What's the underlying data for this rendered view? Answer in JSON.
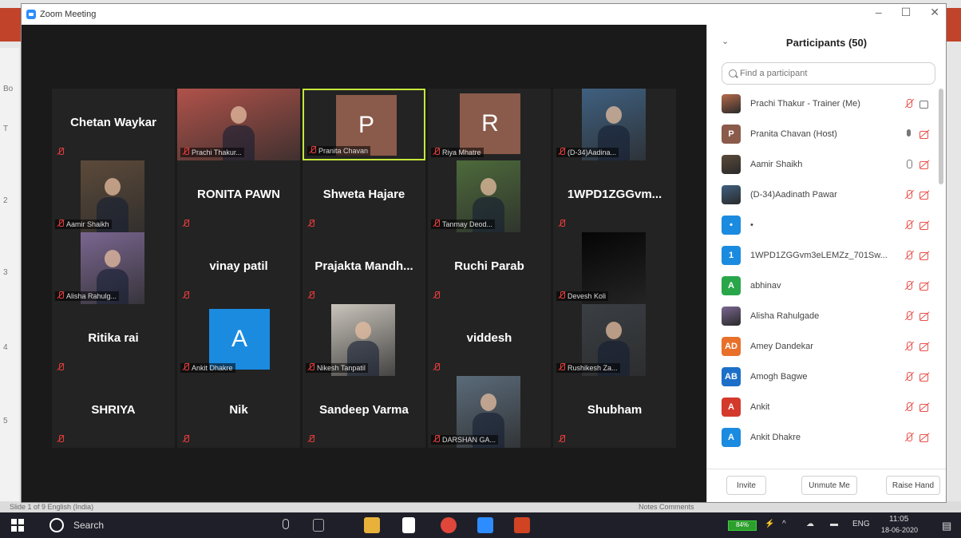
{
  "window": {
    "title": "Zoom Meeting",
    "minimize": "–",
    "maximize": "☐",
    "close": "✕"
  },
  "background_app": {
    "left_labels": [
      "Bo",
      "T",
      "2",
      "3",
      "4",
      "5"
    ],
    "status_left": "Slide 1 of 9    English (India)",
    "status_right": "Notes   Comments"
  },
  "gallery": {
    "tiles": [
      {
        "name": "Chetan Waykar",
        "kind": "text"
      },
      {
        "name": "Prachi Thakur...",
        "kind": "photo",
        "photo_color": "#b0524a"
      },
      {
        "name": "Pranita Chavan",
        "kind": "letter",
        "letter": "P",
        "color": "#8a5a4a",
        "active": true
      },
      {
        "name": "Riya Mhatre",
        "kind": "letter",
        "letter": "R",
        "color": "#8a5a4a"
      },
      {
        "name": "(D-34)Aadina...",
        "kind": "photo",
        "photo_color": "#3f6080"
      },
      {
        "name": "Aamir Shaikh",
        "kind": "photo",
        "photo_color": "#5c4a3a"
      },
      {
        "name": "RONITA PAWN",
        "kind": "text"
      },
      {
        "name": "Shweta Hajare",
        "kind": "text"
      },
      {
        "name": "Tanmay Deod...",
        "kind": "photo",
        "photo_color": "#4d6a3b"
      },
      {
        "name": "1WPD1ZGGvm...",
        "kind": "text"
      },
      {
        "name": "Alisha Rahulg...",
        "kind": "photo",
        "photo_color": "#7a6690"
      },
      {
        "name": "vinay patil",
        "kind": "text"
      },
      {
        "name": "Prajakta  Mandh...",
        "kind": "text"
      },
      {
        "name": "Ruchi Parab",
        "kind": "text"
      },
      {
        "name": "Devesh Koli",
        "kind": "photo",
        "photo_color": "#050505"
      },
      {
        "name": "Ritika rai",
        "kind": "text"
      },
      {
        "name": "Ankit Dhakre",
        "kind": "letter",
        "letter": "A",
        "color": "#1b8be0"
      },
      {
        "name": "Nikesh Tanpatil",
        "kind": "photo",
        "photo_color": "#c9c4bb"
      },
      {
        "name": "viddesh",
        "kind": "text"
      },
      {
        "name": "Rushikesh Za...",
        "kind": "photo",
        "photo_color": "#3a3f44"
      },
      {
        "name": "SHRIYA",
        "kind": "text"
      },
      {
        "name": "Nik",
        "kind": "text"
      },
      {
        "name": "Sandeep Varma",
        "kind": "text"
      },
      {
        "name": "DARSHAN GA...",
        "kind": "photo",
        "photo_color": "#5b6b7a"
      },
      {
        "name": "Shubham",
        "kind": "text"
      }
    ]
  },
  "participants": {
    "title": "Participants (50)",
    "search_placeholder": "Find a participant",
    "list": [
      {
        "name": "Prachi Thakur - Trainer (Me)",
        "avatar_kind": "photo",
        "avatar_color": "#b56a4a",
        "mic": "muted",
        "video": "on"
      },
      {
        "name": "Pranita Chavan (Host)",
        "avatar_kind": "letter",
        "initials": "P",
        "avatar_color": "#8a5a4a",
        "mic": "on",
        "video": "off"
      },
      {
        "name": "Aamir Shaikh",
        "avatar_kind": "photo",
        "avatar_color": "#5c4a3a",
        "mic": "open",
        "video": "off"
      },
      {
        "name": "(D-34)Aadinath Pawar",
        "avatar_kind": "photo",
        "avatar_color": "#3f6080",
        "mic": "muted",
        "video": "off"
      },
      {
        "name": "•",
        "avatar_kind": "letter",
        "initials": "•",
        "avatar_color": "#1b8be0",
        "mic": "muted",
        "video": "off"
      },
      {
        "name": "1WPD1ZGGvm3eLEMZz_701Sw...",
        "avatar_kind": "letter",
        "initials": "1",
        "avatar_color": "#1b8be0",
        "mic": "muted",
        "video": "off"
      },
      {
        "name": "abhinav",
        "avatar_kind": "letter",
        "initials": "A",
        "avatar_color": "#2aa64a",
        "mic": "muted",
        "video": "off"
      },
      {
        "name": "Alisha Rahulgade",
        "avatar_kind": "photo",
        "avatar_color": "#7a6690",
        "mic": "muted",
        "video": "off"
      },
      {
        "name": "Amey Dandekar",
        "avatar_kind": "letter",
        "initials": "AD",
        "avatar_color": "#e8702a",
        "mic": "muted",
        "video": "off"
      },
      {
        "name": "Amogh Bagwe",
        "avatar_kind": "letter",
        "initials": "AB",
        "avatar_color": "#1b6fc8",
        "mic": "muted",
        "video": "off"
      },
      {
        "name": "Ankit",
        "avatar_kind": "letter",
        "initials": "A",
        "avatar_color": "#d33a2c",
        "mic": "muted",
        "video": "off"
      },
      {
        "name": "Ankit Dhakre",
        "avatar_kind": "letter",
        "initials": "A",
        "avatar_color": "#1b8be0",
        "mic": "muted",
        "video": "off"
      }
    ],
    "buttons": {
      "invite": "Invite",
      "unmute": "Unmute Me",
      "raise_hand": "Raise Hand"
    }
  },
  "taskbar": {
    "search_label": "Search",
    "battery": "84%",
    "language": "ENG",
    "time": "11:05",
    "date": "18-06-2020"
  }
}
